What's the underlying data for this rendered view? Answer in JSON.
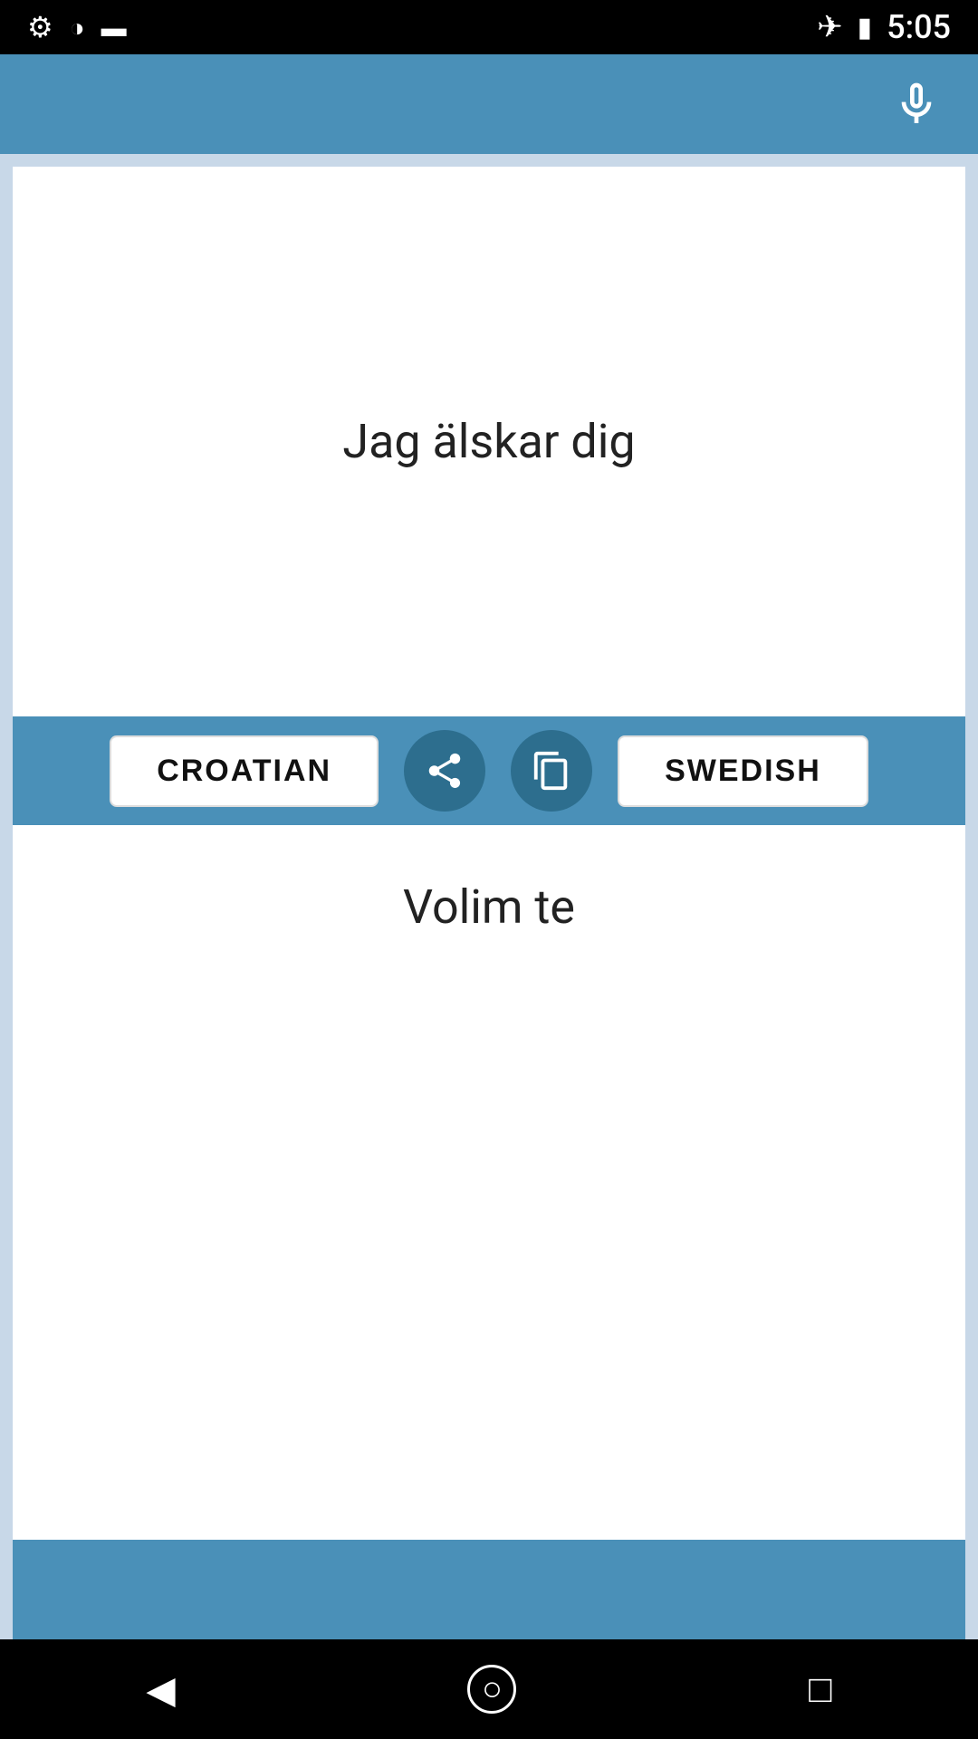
{
  "statusBar": {
    "time": "5:05",
    "icons": {
      "settings": "⚙",
      "circle": "◑",
      "sdcard": "▪",
      "airplane": "✈",
      "battery": "🔋"
    }
  },
  "header": {
    "micIcon": "🎤"
  },
  "sourceText": "Jag älskar dig",
  "controls": {
    "sourceLanguage": "CROATIAN",
    "targetLanguage": "SWEDISH",
    "shareLabel": "share",
    "copyLabel": "copy"
  },
  "translationText": "Volim te",
  "navBar": {
    "backLabel": "◀",
    "homeLabel": "○",
    "recentLabel": "□"
  }
}
